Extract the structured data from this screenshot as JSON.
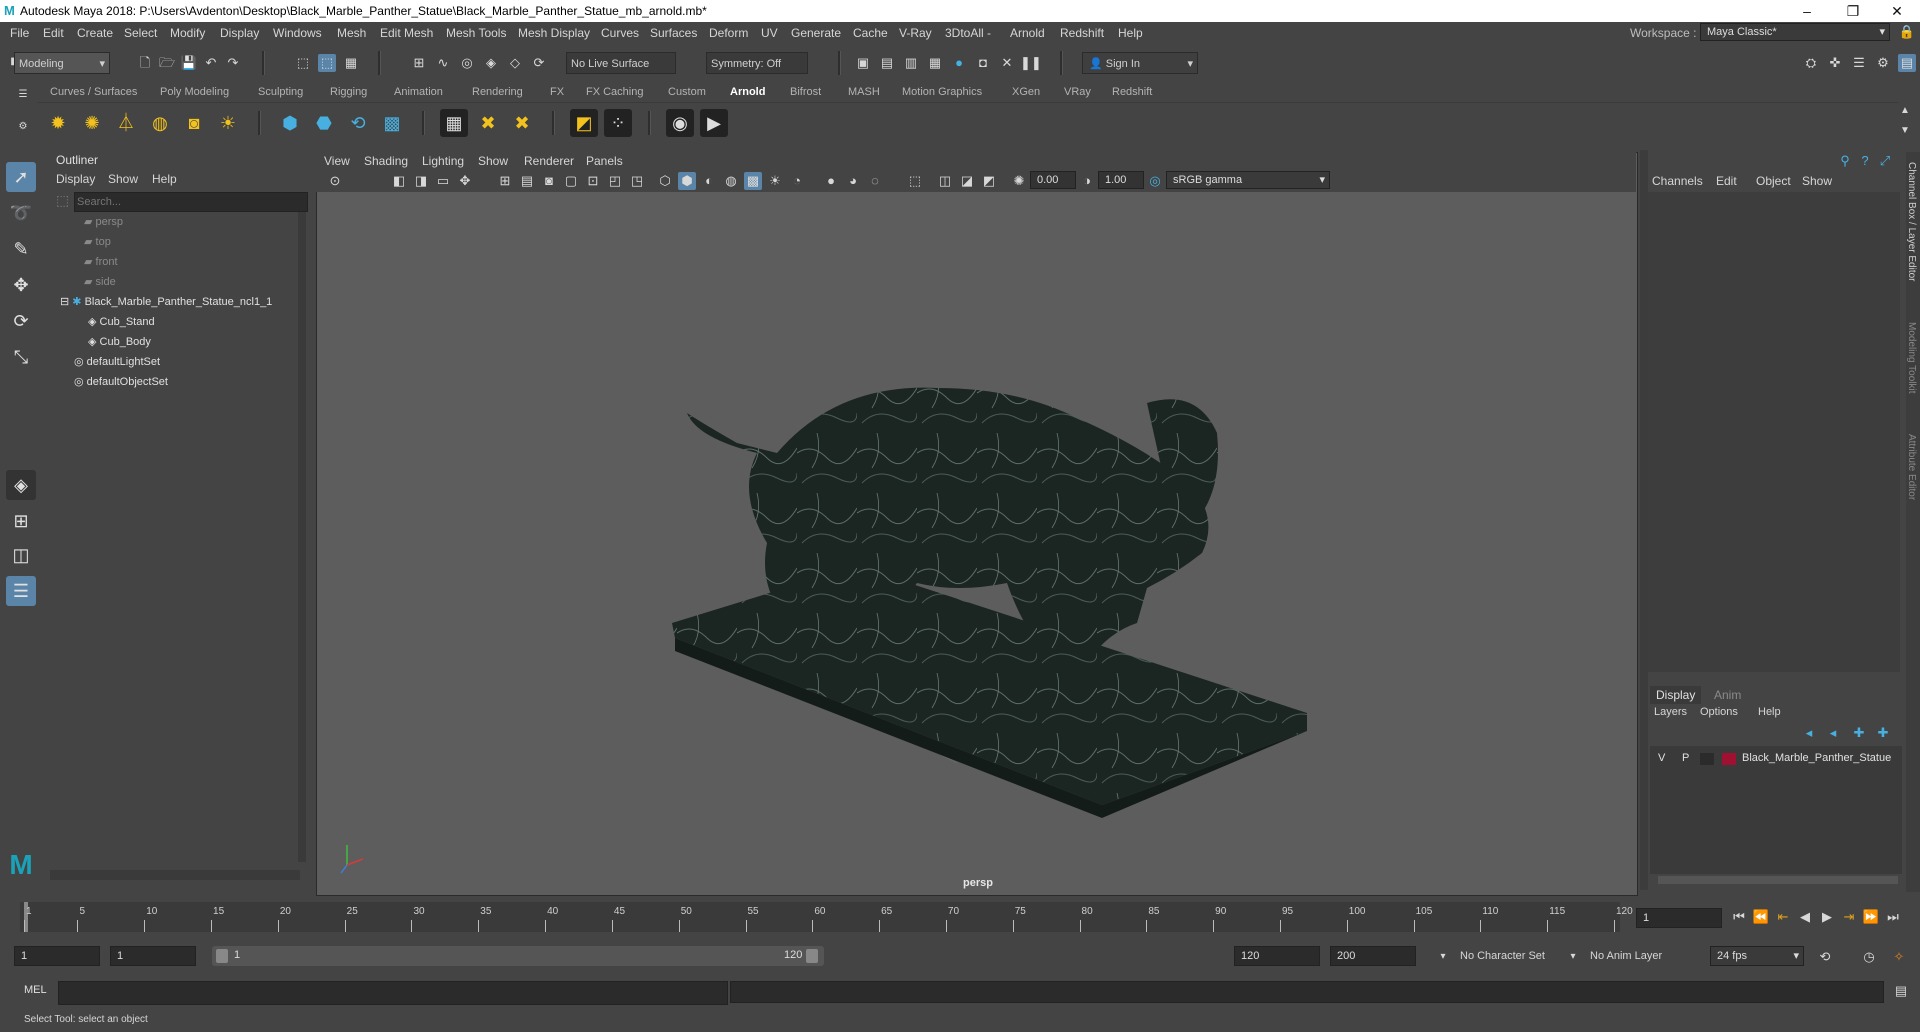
{
  "titlebar": {
    "title": "Autodesk Maya 2018: P:\\Users\\Avdenton\\Desktop\\Black_Marble_Panther_Statue\\Black_Marble_Panther_Statue_mb_arnold.mb*",
    "minimize": "–",
    "maximize": "❐",
    "close": "✕"
  },
  "menubar": [
    "File",
    "Edit",
    "Create",
    "Select",
    "Modify",
    "Display",
    "Windows",
    "Mesh",
    "Edit Mesh",
    "Mesh Tools",
    "Mesh Display",
    "Curves",
    "Surfaces",
    "Deform",
    "UV",
    "Generate",
    "Cache",
    "V-Ray",
    "3DtoAll -",
    "Arnold",
    "Redshift",
    "Help"
  ],
  "workspace": {
    "label": "Workspace :",
    "value": "Maya Classic*"
  },
  "statusline": {
    "mode": "Modeling",
    "live_surface": "No Live Surface",
    "symmetry": "Symmetry: Off",
    "sign_in": "Sign In"
  },
  "shelf_tabs": [
    "Curves / Surfaces",
    "Poly Modeling",
    "Sculpting",
    "Rigging",
    "Animation",
    "Rendering",
    "FX",
    "FX Caching",
    "Custom",
    "Arnold",
    "Bifrost",
    "MASH",
    "Motion Graphics",
    "XGen",
    "VRay",
    "Redshift"
  ],
  "active_shelf_tab": "Arnold",
  "outliner": {
    "title": "Outliner",
    "menus": [
      "Display",
      "Show",
      "Help"
    ],
    "search_placeholder": "Search...",
    "items": [
      {
        "label": "persp",
        "type": "camera",
        "dim": true
      },
      {
        "label": "top",
        "type": "camera",
        "dim": true
      },
      {
        "label": "front",
        "type": "camera",
        "dim": true
      },
      {
        "label": "side",
        "type": "camera",
        "dim": true
      },
      {
        "label": "Black_Marble_Panther_Statue_ncl1_1",
        "type": "group",
        "dim": false
      },
      {
        "label": "Cub_Stand",
        "type": "mesh",
        "dim": false
      },
      {
        "label": "Cub_Body",
        "type": "mesh",
        "dim": false
      },
      {
        "label": "defaultLightSet",
        "type": "set",
        "dim": false
      },
      {
        "label": "defaultObjectSet",
        "type": "set",
        "dim": false
      }
    ]
  },
  "viewport": {
    "menus": [
      "View",
      "Shading",
      "Lighting",
      "Show",
      "Renderer",
      "Panels"
    ],
    "exposure": "0.00",
    "gamma": "1.00",
    "color_space": "sRGB gamma",
    "camera_label": "persp"
  },
  "channelbox": {
    "menus": [
      "Channels",
      "Edit",
      "Object",
      "Show"
    ],
    "side_tabs": [
      "Channel Box / Layer Editor",
      "Modeling Toolkit",
      "Attribute Editor"
    ]
  },
  "layereditor": {
    "tabs": [
      "Display",
      "Anim"
    ],
    "menus": [
      "Layers",
      "Options",
      "Help"
    ],
    "layer": {
      "v": "V",
      "p": "P",
      "name": "Black_Marble_Panther_Statue",
      "color": "#a01030"
    }
  },
  "timeline": {
    "ticks": [
      "1",
      "5",
      "10",
      "15",
      "20",
      "25",
      "30",
      "35",
      "40",
      "45",
      "50",
      "55",
      "60",
      "65",
      "70",
      "75",
      "80",
      "85",
      "90",
      "95",
      "100",
      "105",
      "110",
      "115",
      "120"
    ],
    "current_frame": "1"
  },
  "range": {
    "start": "1",
    "playback_start": "1",
    "slider_start": "1",
    "slider_end": "120",
    "playback_end": "120",
    "end": "200",
    "character_set": "No Character Set",
    "anim_layer": "No Anim Layer",
    "fps": "24 fps"
  },
  "cmdline": {
    "label": "MEL"
  },
  "helpline": {
    "text": "Select Tool: select an object"
  },
  "colors": {
    "accent": "#4aa3d8",
    "bg": "#444444",
    "viewport": "#5d5d5d",
    "marble": "#1f2a26"
  }
}
